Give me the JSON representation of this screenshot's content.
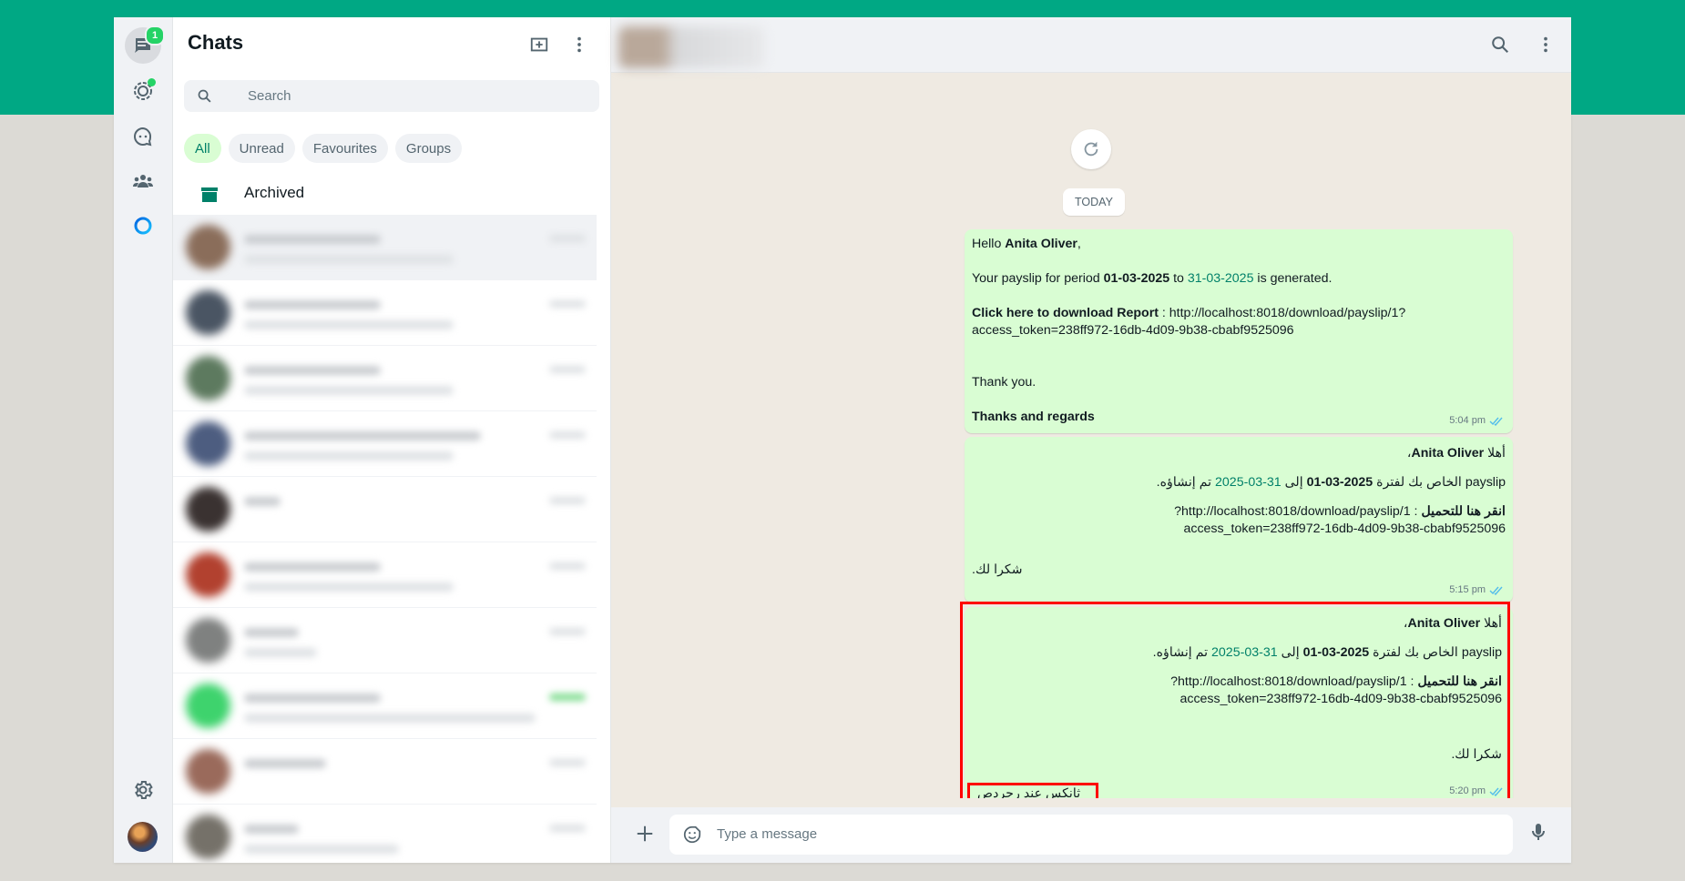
{
  "rail": {
    "chats_badge": "1"
  },
  "list": {
    "title": "Chats",
    "search_placeholder": "Search",
    "filters": [
      "All",
      "Unread",
      "Favourites",
      "Groups"
    ],
    "archived_label": "Archived"
  },
  "conversation": {
    "day_label": "TODAY",
    "messages": [
      {
        "hello": "Hello ",
        "name": "Anita Oliver",
        "comma": ",",
        "period_pre": "Your payslip for period ",
        "date_from": "01-03-2025",
        "to": " to ",
        "date_to": "31-03-2025",
        "generated": " is generated.",
        "download_label": "Click here to download Report",
        "download_sep": " : ",
        "url_line1": "http://localhost:8018/download/payslip/1?",
        "url_line2": "access_token=238ff972-16db-4d09-9b38-cbabf9525096",
        "thanks": "Thank you.",
        "regards": "Thanks and regards",
        "time": "5:04 pm"
      },
      {
        "hello": "أهلا ",
        "name": "Anita Oliver",
        "comma": "،",
        "line2_a": "payslip الخاص بك لفترة ",
        "date_from": "2025-03-01",
        "line2_b": " إلى ",
        "date_to": "31-03-2025",
        "line2_c": " تم إنشاؤه.",
        "download_label": "انقر هنا للتحميل",
        "url_line1": " : http://localhost:8018/download/payslip/1?",
        "url_line2": "access_token=238ff972-16db-4d09-9b38-cbabf9525096",
        "thanks": "شكرا لك.",
        "time": "5:15 pm"
      },
      {
        "hello": "أهلا ",
        "name": "Anita Oliver",
        "comma": "،",
        "line2_a": "payslip الخاص بك لفترة ",
        "date_from": "2025-03-01",
        "line2_b": " إلى ",
        "date_to": "31-03-2025",
        "line2_c": " تم إنشاؤه.",
        "download_label": "انقر هنا للتحميل",
        "url_line1": " : http://localhost:8018/download/payslip/1?",
        "url_line2": "access_token=238ff972-16db-4d09-9b38-cbabf9525096",
        "thanks": "شكرا لك.",
        "signoff": "ثانكس عند رجردص",
        "time": "5:20 pm"
      }
    ]
  },
  "composer": {
    "placeholder": "Type a message"
  },
  "colors": {
    "brand": "#00a884",
    "bubble_out": "#d9fdd3",
    "highlight": "#ff0000",
    "link_green": "#008069"
  }
}
